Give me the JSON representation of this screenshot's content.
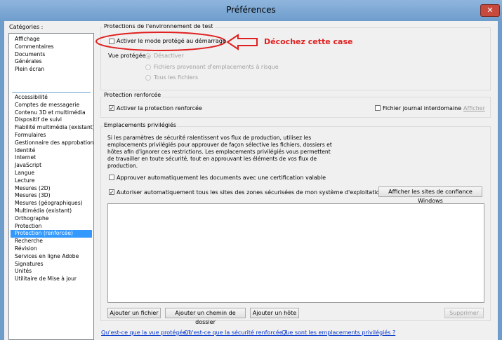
{
  "window": {
    "title": "Préférences",
    "close_label": "✕"
  },
  "categories": {
    "label": "Catégories :",
    "top_items": [
      "Affichage",
      "Commentaires",
      "Documents",
      "Générales",
      "Plein écran"
    ],
    "items": [
      "Accessibilité",
      "Comptes de messagerie",
      "Contenu 3D et multimédia",
      "Dispositif de suivi",
      "Fiabilité multimédia (existant)",
      "Formulaires",
      "Gestionnaire des approbations",
      "Identité",
      "Internet",
      "JavaScript",
      "Langue",
      "Lecture",
      "Mesures (2D)",
      "Mesures (3D)",
      "Mesures (géographiques)",
      "Multimédia (existant)",
      "Orthographe",
      "Protection",
      "Protection (renforcée)",
      "Recherche",
      "Révision",
      "Services en ligne Adobe",
      "Signatures",
      "Unités",
      "Utilitaire de Mise à jour"
    ],
    "selected": "Protection (renforcée)"
  },
  "sandbox": {
    "title": "Protections de l'environnement de test",
    "protected_mode_label": "Activer le mode protégé au démarrage",
    "protected_view_label": "Vue protégée",
    "radio_disable": "Désactiver",
    "radio_unsafe": "Fichiers provenant d'emplacements à risque",
    "radio_all": "Tous les fichiers"
  },
  "annotation": {
    "text": "Décochez cette case",
    "color": "#e02020"
  },
  "enhanced": {
    "title": "Protection renforcée",
    "enable_label": "Activer la protection renforcée",
    "crossdomain_label": "Fichier journal interdomaine",
    "show_link": "Afficher"
  },
  "privileged": {
    "title": "Emplacements privilégiés",
    "description": "Si les paramètres de sécurité ralentissent vos flux de production, utilisez les emplacements privilégiés pour approuver de façon sélective les fichiers, dossiers et hôtes afin d'ignorer ces restrictions. Les emplacements privilégiés vous permettent de travailler en toute sécurité, tout en approuvant les éléments de vos flux de production.",
    "auto_cert_label": "Approuver automatiquement les documents avec une certification valable",
    "auto_win_label": "Autoriser automatiquement tous les sites des zones sécurisées de mon système d'exploitation Windows",
    "show_win_sites": "Afficher les sites de confiance Windows",
    "add_file": "Ajouter un fichier",
    "add_folder": "Ajouter un chemin de dossier",
    "add_host": "Ajouter un hôte",
    "remove": "Supprimer"
  },
  "footer_links": [
    "Qu'est-ce que la vue protégée ?",
    "Qu'est-ce que la sécurité renforcée ?",
    "Que sont les emplacements privilégiés ?"
  ],
  "checks": {
    "protected_mode": false,
    "enhanced": true,
    "crossdomain": false,
    "auto_cert": false,
    "auto_win": true
  }
}
